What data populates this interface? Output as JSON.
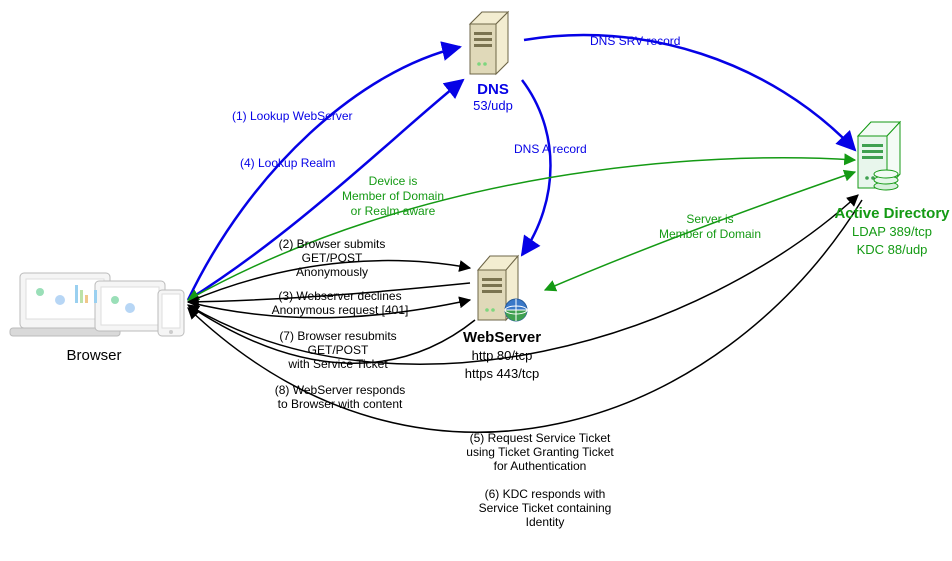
{
  "nodes": {
    "browser": {
      "title": "Browser"
    },
    "dns": {
      "title": "DNS",
      "sub1": "53/udp"
    },
    "web": {
      "title": "WebServer",
      "sub1": "http 80/tcp",
      "sub2": "https  443/tcp"
    },
    "ad": {
      "title": "Active Directory",
      "sub1": "LDAP 389/tcp",
      "sub2": "KDC 88/udp"
    }
  },
  "labels": {
    "l1": "(1) Lookup WebServer",
    "l4": "(4) Lookup Realm",
    "srv": "DNS SRV record",
    "arec": "DNS A record",
    "devL1": "Device is",
    "devL2": "Member of Domain",
    "devL3": "or Realm aware",
    "srvL1": "Server is",
    "srvL2": "Member of Domain",
    "l2a": "(2) Browser submits",
    "l2b": "GET/POST",
    "l2c": "Anonymously",
    "l3a": "(3) Webserver declines",
    "l3b": "Anonymous request [401]",
    "l7a": "(7) Browser resubmits",
    "l7b": "GET/POST",
    "l7c": "with Service Ticket",
    "l8a": "(8) WebServer responds",
    "l8b": "to Browser with content",
    "l5a": "(5) Request Service Ticket",
    "l5b": "using Ticket Granting Ticket",
    "l5c": "for Authentication",
    "l6a": "(6) KDC responds with",
    "l6b": "Service Ticket containing",
    "l6c": "Identity"
  }
}
